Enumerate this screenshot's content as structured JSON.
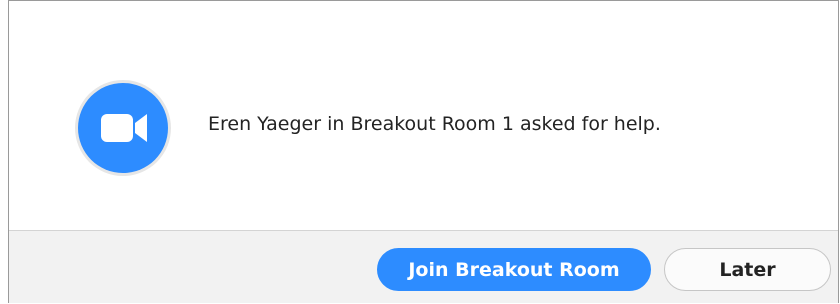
{
  "notification": {
    "message": "Eren Yaeger in Breakout Room 1 asked for help.",
    "icon": "zoom-video-camera-icon"
  },
  "actions": {
    "join_label": "Join Breakout Room",
    "later_label": "Later"
  },
  "colors": {
    "accent": "#2d8cff",
    "text": "#232323",
    "footer_bg": "#f2f2f2"
  }
}
